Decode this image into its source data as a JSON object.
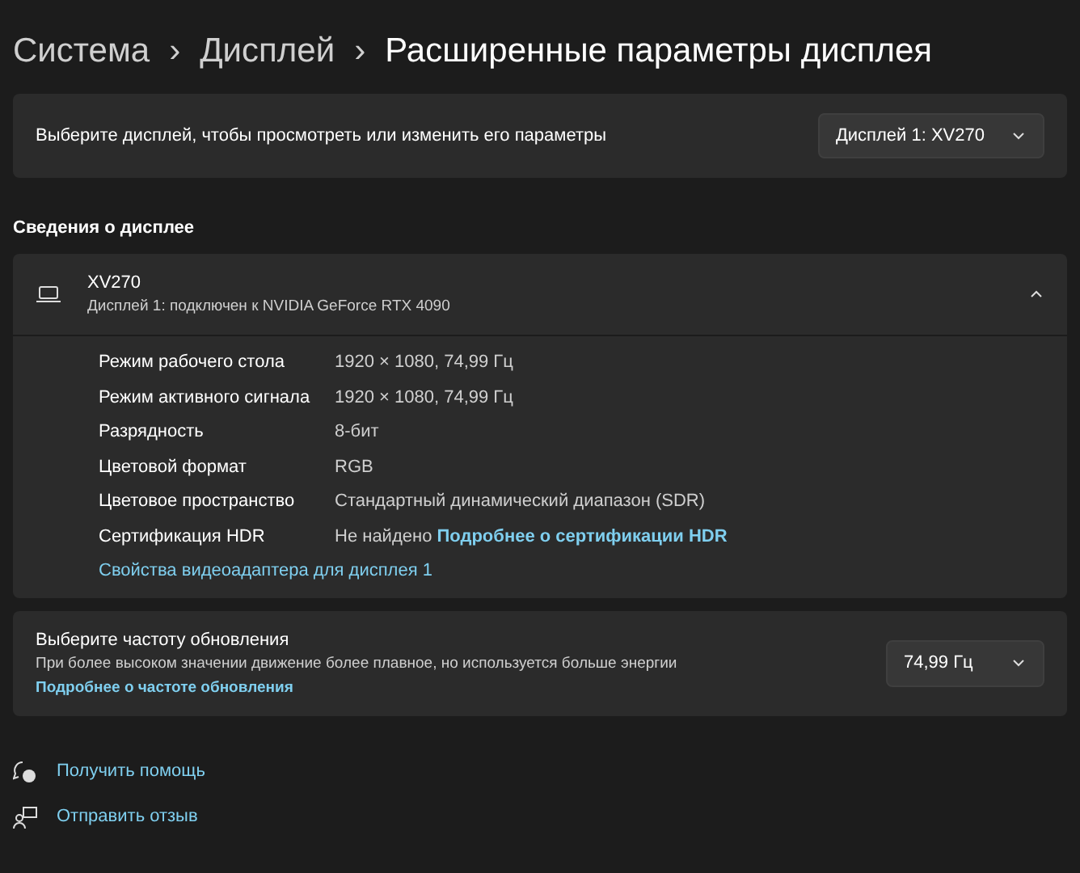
{
  "breadcrumb": [
    "Система",
    "Дисплей",
    "Расширенные параметры дисплея"
  ],
  "breadcrumb_separator": "›",
  "display_select": {
    "label": "Выберите дисплей, чтобы просмотреть или изменить его параметры",
    "value": "Дисплей 1: XV270"
  },
  "section_title": "Сведения о дисплее",
  "display_info": {
    "name": "XV270",
    "subtitle": "Дисплей 1: подключен к NVIDIA GeForce RTX 4090",
    "expanded": true,
    "rows": [
      {
        "label": "Режим рабочего стола",
        "value": "1920 × 1080, 74,99 Гц"
      },
      {
        "label": "Режим активного сигнала",
        "value": "1920 × 1080, 74,99 Гц"
      },
      {
        "label": "Разрядность",
        "value": "8-бит"
      },
      {
        "label": "Цветовой формат",
        "value": "RGB"
      },
      {
        "label": "Цветовое пространство",
        "value": "Стандартный динамический диапазон (SDR)"
      },
      {
        "label": "Сертификация HDR",
        "value": "Не найдено",
        "link": "Подробнее о сертификации HDR"
      }
    ],
    "adapter_link": "Свойства видеоадаптера для дисплея 1"
  },
  "refresh_rate": {
    "title": "Выберите частоту обновления",
    "description": "При более высоком значении движение более плавное, но используется больше энергии",
    "link": "Подробнее о частоте обновления",
    "value": "74,99 Гц"
  },
  "footer_links": [
    {
      "kind": "help",
      "label": "Получить помощь"
    },
    {
      "kind": "feedback",
      "label": "Отправить отзыв"
    }
  ]
}
